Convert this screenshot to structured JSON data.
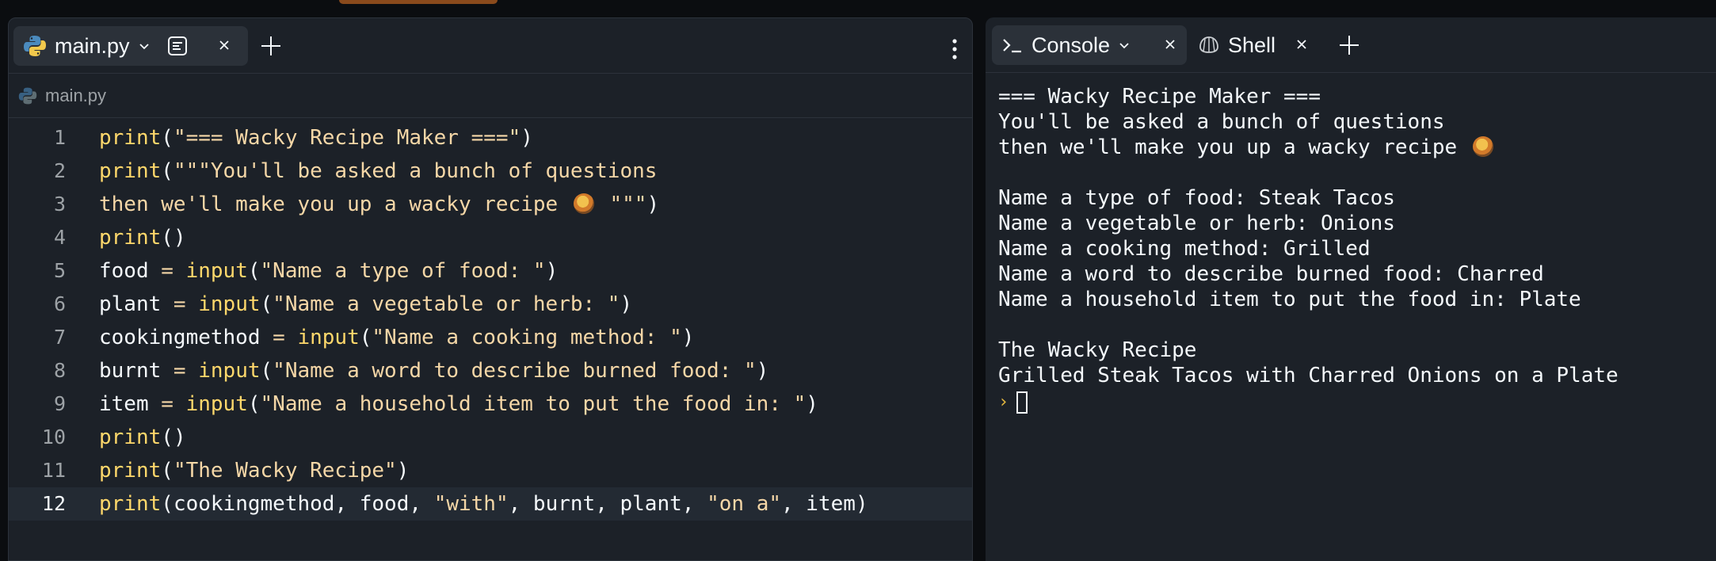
{
  "editor": {
    "tab_label": "main.py",
    "breadcrumb": "main.py",
    "lines": [
      {
        "n": "1",
        "text": "print(\"=== Wacky Recipe Maker ===\")"
      },
      {
        "n": "2",
        "text": "print(\"\"\"You'll be asked a bunch of questions"
      },
      {
        "n": "3",
        "text": "then we'll make you up a wacky recipe",
        "emoji": true,
        "tail": " \"\"\")"
      },
      {
        "n": "4",
        "text": "print()"
      },
      {
        "n": "5",
        "text": "food = input(\"Name a type of food: \")"
      },
      {
        "n": "6",
        "text": "plant = input(\"Name a vegetable or herb: \")"
      },
      {
        "n": "7",
        "text": "cookingmethod = input(\"Name a cooking method: \")"
      },
      {
        "n": "8",
        "text": "burnt = input(\"Name a word to describe burned food: \")"
      },
      {
        "n": "9",
        "text": "item = input(\"Name a household item to put the food in: \")"
      },
      {
        "n": "10",
        "text": "print()"
      },
      {
        "n": "11",
        "text": "print(\"The Wacky Recipe\")"
      },
      {
        "n": "12",
        "text": "print(cookingmethod, food, \"with\", burnt, plant, \"on a\", item)"
      }
    ],
    "current_line": "12"
  },
  "console": {
    "tab_console": "Console",
    "tab_shell": "Shell",
    "output": [
      "=== Wacky Recipe Maker ===",
      "You'll be asked a bunch of questions",
      "then we'll make you up a wacky recipe",
      "",
      "Name a type of food: Steak Tacos",
      "Name a vegetable or herb: Onions",
      "Name a cooking method: Grilled",
      "Name a word to describe burned food: Charred",
      "Name a household item to put the food in: Plate",
      "",
      "The Wacky Recipe",
      "Grilled Steak Tacos with Charred Onions on a Plate"
    ],
    "emoji_line_index": 2,
    "prompt_glyph": "›"
  },
  "colors": {
    "background": "#1c2128",
    "tab_active": "#2b3139",
    "string": "#f5d7a7",
    "builtin": "#ffd86b",
    "prompt": "#e5b93f"
  },
  "icons": [
    "python-icon",
    "chevron-down-icon",
    "preview-icon",
    "close-icon",
    "plus-icon",
    "kebab-menu-icon",
    "terminal-icon",
    "shell-icon"
  ]
}
